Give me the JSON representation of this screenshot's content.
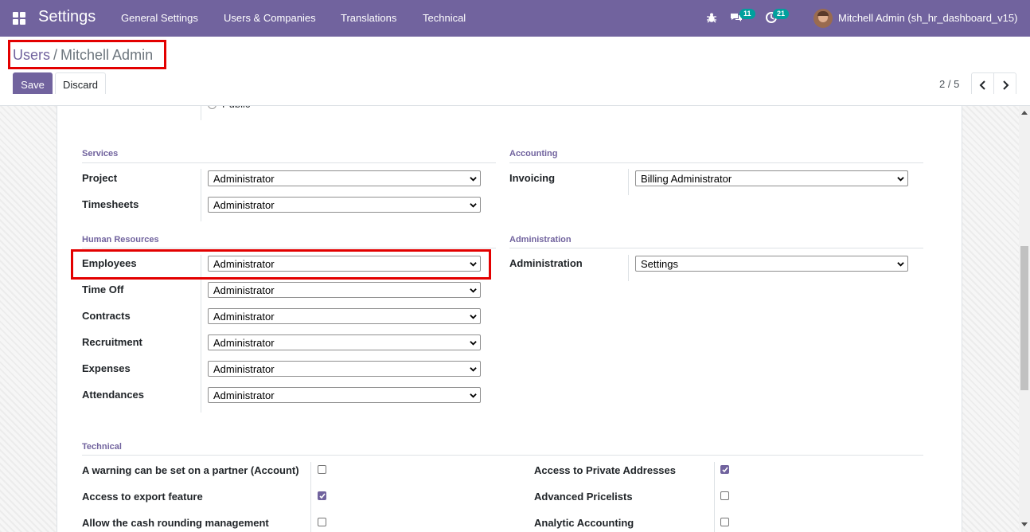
{
  "navbar": {
    "app_title": "Settings",
    "menu": [
      "General Settings",
      "Users & Companies",
      "Translations",
      "Technical"
    ],
    "messages_count": "11",
    "activities_count": "21",
    "user_name": "Mitchell Admin (sh_hr_dashboard_v15)",
    "icons": [
      "apps-grid-icon",
      "bug-icon",
      "chat-icon",
      "clock-icon",
      "avatar"
    ]
  },
  "breadcrumb": {
    "parent": "Users",
    "separator": "/",
    "current": "Mitchell Admin"
  },
  "buttons": {
    "save": "Save",
    "discard": "Discard"
  },
  "pager": {
    "value": "2 / 5"
  },
  "cut_off_radio_label": "Public",
  "sections": {
    "services": {
      "title": "Services",
      "fields": [
        {
          "label": "Project",
          "value": "Administrator"
        },
        {
          "label": "Timesheets",
          "value": "Administrator"
        }
      ]
    },
    "accounting": {
      "title": "Accounting",
      "fields": [
        {
          "label": "Invoicing",
          "value": "Billing Administrator"
        }
      ]
    },
    "human_resources": {
      "title": "Human Resources",
      "fields": [
        {
          "label": "Employees",
          "value": "Administrator"
        },
        {
          "label": "Time Off",
          "value": "Administrator"
        },
        {
          "label": "Contracts",
          "value": "Administrator"
        },
        {
          "label": "Recruitment",
          "value": "Administrator"
        },
        {
          "label": "Expenses",
          "value": "Administrator"
        },
        {
          "label": "Attendances",
          "value": "Administrator"
        }
      ]
    },
    "administration": {
      "title": "Administration",
      "fields": [
        {
          "label": "Administration",
          "value": "Settings"
        }
      ]
    },
    "technical": {
      "title": "Technical",
      "left": [
        {
          "label": "A warning can be set on a partner (Account)",
          "checked": false
        },
        {
          "label": "Access to export feature",
          "checked": true
        },
        {
          "label": "Allow the cash rounding management",
          "checked": false
        }
      ],
      "right": [
        {
          "label": "Access to Private Addresses",
          "checked": true
        },
        {
          "label": "Advanced Pricelists",
          "checked": false
        },
        {
          "label": "Analytic Accounting",
          "checked": false
        }
      ]
    }
  },
  "colors": {
    "brand": "#71639e",
    "badge": "#00a09d",
    "highlight": "#e30000"
  }
}
